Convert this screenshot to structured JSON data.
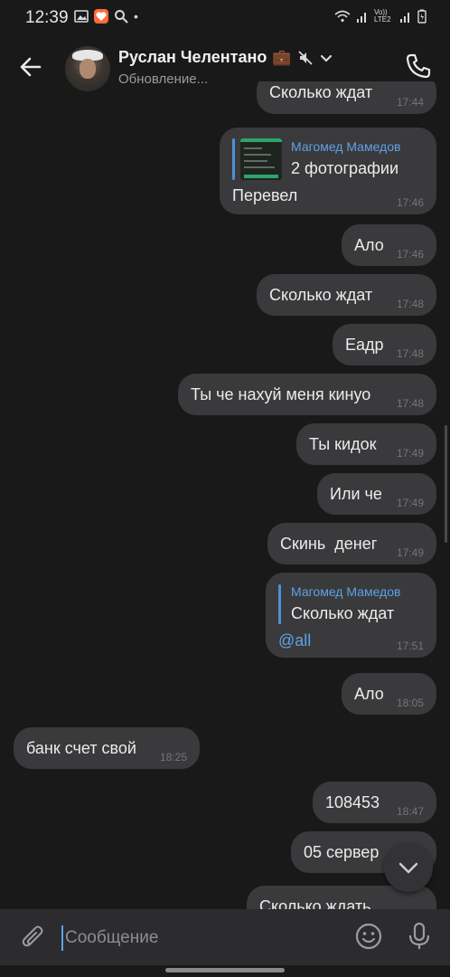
{
  "status_bar": {
    "time": "12:39",
    "dot": "•",
    "network": "Vo)) LTE2"
  },
  "header": {
    "name": "Руслан Челентано",
    "name_emoji": "💼",
    "status": "Обновление..."
  },
  "colors": {
    "background": "#19191a",
    "bubble": "#3a3a3c",
    "accent": "#5ea2e6",
    "timestamp": "#757577"
  },
  "messages": [
    {
      "id": "m0",
      "text": "Сколько ждат",
      "time": "17:44",
      "outgoing": true
    },
    {
      "id": "m1",
      "reply_author": "Магомед Мамедов",
      "reply_text": "2 фотографии",
      "text": "Перевел",
      "time": "17:46",
      "outgoing": true
    },
    {
      "id": "m2",
      "text": "Ало",
      "time": "17:46",
      "outgoing": true
    },
    {
      "id": "m3",
      "text": "Сколько ждат",
      "time": "17:48",
      "outgoing": true
    },
    {
      "id": "m4",
      "text": "Еадр",
      "time": "17:48",
      "outgoing": true
    },
    {
      "id": "m5",
      "text": "Ты че нахуй меня кинуо",
      "time": "17:48",
      "outgoing": true
    },
    {
      "id": "m6",
      "text": "Ты кидок",
      "time": "17:49",
      "outgoing": true
    },
    {
      "id": "m7",
      "text": "Или че",
      "time": "17:49",
      "outgoing": true
    },
    {
      "id": "m8",
      "text": "Скинь  денег",
      "time": "17:49",
      "outgoing": true
    },
    {
      "id": "m9",
      "reply_author": "Магомед Мамедов",
      "reply_text": "Сколько ждат",
      "text": "@all",
      "time": "17:51",
      "outgoing": true
    },
    {
      "id": "m10",
      "text": "Ало",
      "time": "18:05",
      "outgoing": true
    },
    {
      "id": "m11",
      "text": "банк счет свой",
      "time": "18:25",
      "outgoing": false
    },
    {
      "id": "m12",
      "text": "108453",
      "time": "18:47",
      "outgoing": true
    },
    {
      "id": "m13",
      "text": "05 сервер",
      "time": "",
      "outgoing": true
    },
    {
      "id": "m14",
      "text": "Сколько ждать",
      "time": "",
      "outgoing": true
    }
  ],
  "composer": {
    "placeholder": "Сообщение"
  },
  "icons": {
    "back": "back-arrow-icon",
    "mute": "muted-icon",
    "dropdown": "chevron-down-icon",
    "call": "phone-icon",
    "attach": "paperclip-icon",
    "emoji": "emoji-icon",
    "mic": "microphone-icon",
    "scroll_down": "chevron-down-icon"
  }
}
